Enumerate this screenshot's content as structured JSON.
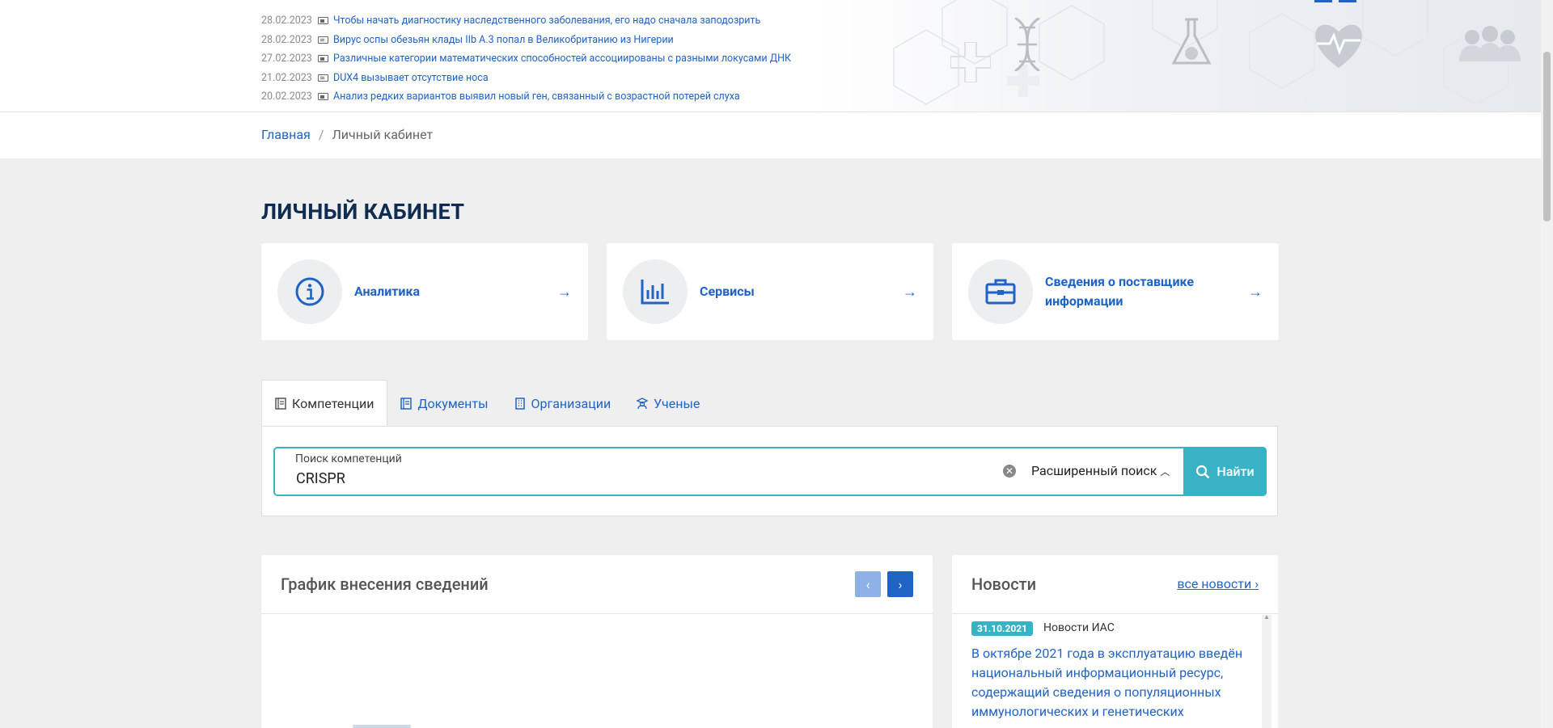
{
  "news_ticker": [
    {
      "date": "28.02.2023",
      "title": "Чтобы начать диагностику наследственного заболевания, его надо сначала заподозрить"
    },
    {
      "date": "28.02.2023",
      "title": "Вирус оспы обезьян клады IIb A.3 попал в Великобританию из Нигерии"
    },
    {
      "date": "27.02.2023",
      "title": "Различные категории математических способностей ассоциированы с разными локусами ДНК"
    },
    {
      "date": "21.02.2023",
      "title": "DUX4 вызывает отсутствие носа"
    },
    {
      "date": "20.02.2023",
      "title": "Анализ редких вариантов выявил новый ген, связанный с возрастной потерей слуха"
    }
  ],
  "breadcrumb": {
    "home": "Главная",
    "separator": "/",
    "current": "Личный кабинет"
  },
  "page_title": "ЛИЧНЫЙ КАБИНЕТ",
  "cards": [
    {
      "label": "Аналитика",
      "icon": "info-icon"
    },
    {
      "label": "Сервисы",
      "icon": "bar-chart-icon"
    },
    {
      "label": "Сведения о поставщике информации",
      "icon": "briefcase-icon"
    }
  ],
  "tabs": [
    {
      "label": "Компетенции",
      "icon": "book-icon",
      "active": true
    },
    {
      "label": "Документы",
      "icon": "document-icon"
    },
    {
      "label": "Организации",
      "icon": "building-icon"
    },
    {
      "label": "Ученые",
      "icon": "scholar-icon"
    }
  ],
  "search": {
    "label": "Поиск компетенций",
    "value": "CRISPR",
    "advanced_label": "Расширенный поиск",
    "button_label": "Найти"
  },
  "chart_panel": {
    "title": "График внесения сведений"
  },
  "news_panel": {
    "title": "Новости",
    "all_link": "все новости",
    "item": {
      "date": "31.10.2021",
      "category": "Новости ИАС",
      "text": "В октябре 2021 года в эксплуатацию введён национальный информационный ресурс, содержащий сведения о популяционных иммунологических и генетических"
    }
  },
  "colors": {
    "accent": "#1f63c7",
    "teal": "#38b3c6",
    "title": "#0f2d52"
  }
}
